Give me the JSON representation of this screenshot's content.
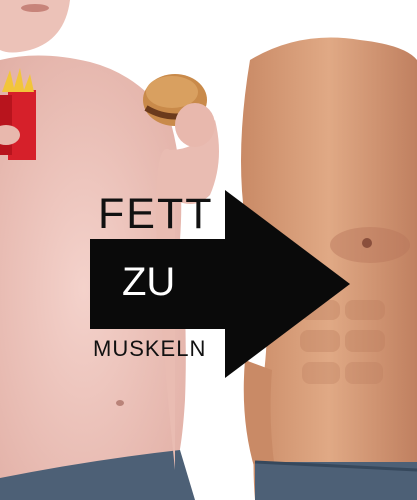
{
  "caption": {
    "line1": "FETT",
    "line2": "ZU",
    "line3": "MUSKELN"
  },
  "colors": {
    "background": "#ffffff",
    "overlay_dark": "#0a0a0a",
    "text_dark": "#111111",
    "text_light": "#ffffff",
    "skin_left": "#eec8c0",
    "skin_right": "#d9a07d",
    "denim": "#4d6076",
    "fries_box": "#d6202a",
    "fries": "#f2c53a",
    "bun": "#c98a4a"
  }
}
